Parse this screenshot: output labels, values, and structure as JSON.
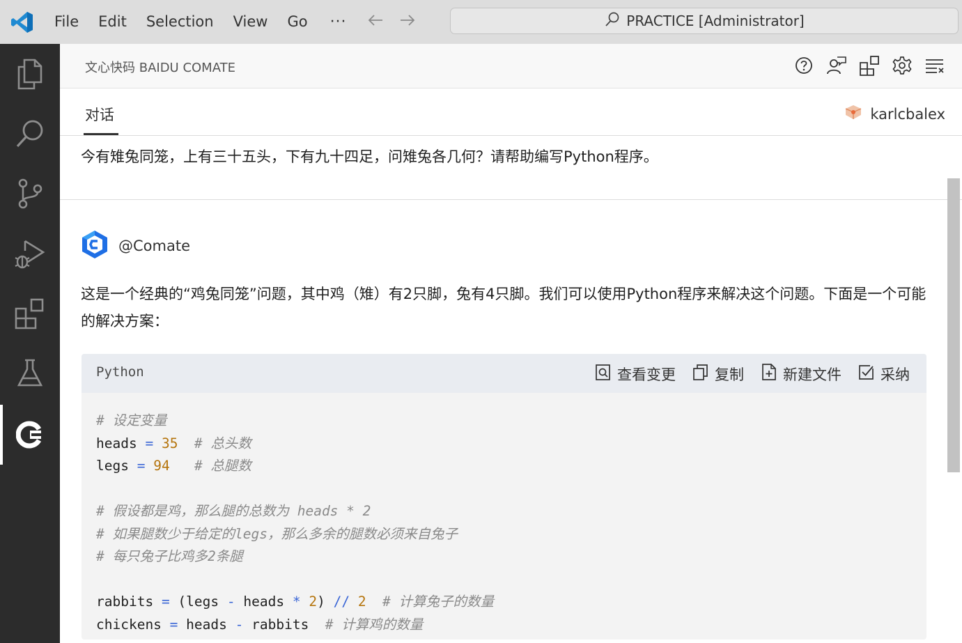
{
  "titlebar": {
    "menu": [
      "File",
      "Edit",
      "Selection",
      "View",
      "Go"
    ],
    "more": "···",
    "command_center": "PRACTICE [Administrator]"
  },
  "panel": {
    "title": "文心快码 BAIDU COMATE",
    "tab": "对话",
    "user": "karlcbalex"
  },
  "chat": {
    "question": "今有雉兔同笼，上有三十五头，下有九十四足，问雉兔各几何？请帮助编写Python程序。",
    "bot_name": "@Comate",
    "answer": "这是一个经典的“鸡兔同笼”问题，其中鸡（雉）有2只脚，兔有4只脚。我们可以使用Python程序来解决这个问题。下面是一个可能的解决方案："
  },
  "code_block": {
    "language": "Python",
    "actions": [
      "查看变更",
      "复制",
      "新建文件",
      "采纳"
    ],
    "lines": {
      "l1_comment": "# 设定变量",
      "l2_var": "heads",
      "l2_num": "35",
      "l2_comment": "# 总头数",
      "l3_var": "legs",
      "l3_num": "94",
      "l3_comment": "# 总腿数",
      "l5_comment": "# 假设都是鸡，那么腿的总数为 heads * 2",
      "l6_comment": "# 如果腿数少于给定的legs，那么多余的腿数必须来自兔子",
      "l7_comment": "# 每只兔子比鸡多2条腿",
      "l9_var": "rabbits",
      "l9_a": "legs",
      "l9_b": "heads",
      "l9_n1": "2",
      "l9_n2": "2",
      "l9_comment": "# 计算兔子的数量",
      "l10_var": "chickens",
      "l10_a": "heads",
      "l10_b": "rabbits",
      "l10_comment": "# 计算鸡的数量"
    }
  },
  "colors": {
    "titlebar_bg": "#dddddd",
    "activitybar_bg": "#2c2c2c",
    "vscode_blue": "#1f8ad2",
    "comate_blue": "#1f6fe5",
    "code_number": "#b5740c",
    "code_operator": "#3a66d6",
    "code_comment": "#8a8a8a"
  },
  "icons": [
    "vscode-logo-icon",
    "search-icon",
    "arrow-left-icon",
    "arrow-right-icon",
    "explorer-icon",
    "source-control-icon",
    "run-debug-icon",
    "extensions-icon",
    "testing-icon",
    "comate-icon",
    "help-icon",
    "chat-user-icon",
    "plugins-icon",
    "gear-icon",
    "clear-icon",
    "user-avatar-icon",
    "comate-logo-icon",
    "view-diff-icon",
    "copy-icon",
    "new-file-icon",
    "accept-icon"
  ]
}
